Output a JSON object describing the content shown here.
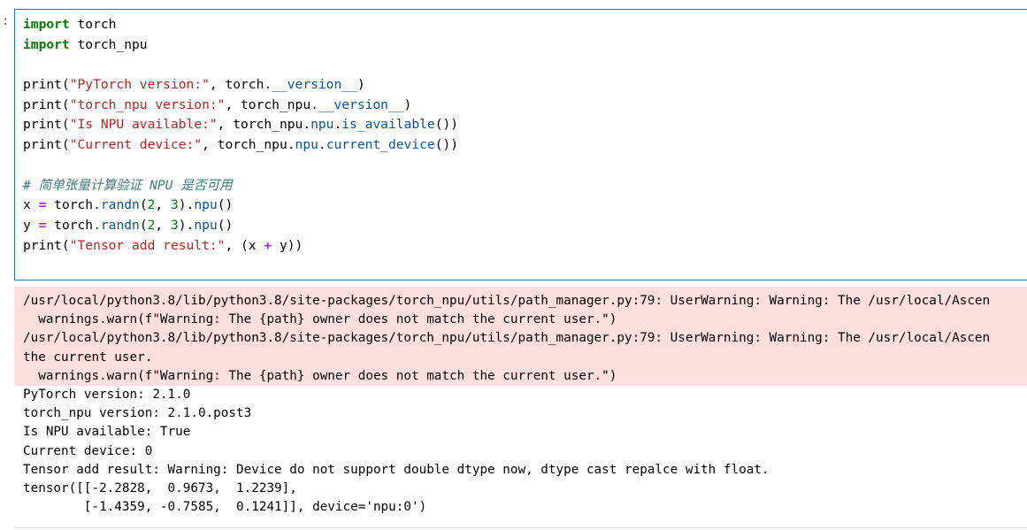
{
  "cell": {
    "prompt": ":",
    "code_lines": [
      [
        {
          "t": "kw",
          "v": "import"
        },
        {
          "t": "plain",
          "v": " torch"
        }
      ],
      [
        {
          "t": "kw",
          "v": "import"
        },
        {
          "t": "plain",
          "v": " torch_npu"
        }
      ],
      [],
      [
        {
          "t": "plain",
          "v": "print("
        },
        {
          "t": "str",
          "v": "\"PyTorch version:\""
        },
        {
          "t": "plain",
          "v": ", torch."
        },
        {
          "t": "attr",
          "v": "__version__"
        },
        {
          "t": "plain",
          "v": ")"
        }
      ],
      [
        {
          "t": "plain",
          "v": "print("
        },
        {
          "t": "str",
          "v": "\"torch_npu version:\""
        },
        {
          "t": "plain",
          "v": ", torch_npu."
        },
        {
          "t": "attr",
          "v": "__version__"
        },
        {
          "t": "plain",
          "v": ")"
        }
      ],
      [
        {
          "t": "plain",
          "v": "print("
        },
        {
          "t": "str",
          "v": "\"Is NPU available:\""
        },
        {
          "t": "plain",
          "v": ", torch_npu."
        },
        {
          "t": "attr",
          "v": "npu"
        },
        {
          "t": "plain",
          "v": "."
        },
        {
          "t": "attr",
          "v": "is_available"
        },
        {
          "t": "plain",
          "v": "())"
        }
      ],
      [
        {
          "t": "plain",
          "v": "print("
        },
        {
          "t": "str",
          "v": "\"Current device:\""
        },
        {
          "t": "plain",
          "v": ", torch_npu."
        },
        {
          "t": "attr",
          "v": "npu"
        },
        {
          "t": "plain",
          "v": "."
        },
        {
          "t": "attr",
          "v": "current_device"
        },
        {
          "t": "plain",
          "v": "())"
        }
      ],
      [],
      [
        {
          "t": "cmt",
          "v": "# 简单张量计算验证 NPU 是否可用"
        }
      ],
      [
        {
          "t": "plain",
          "v": "x "
        },
        {
          "t": "op",
          "v": "="
        },
        {
          "t": "plain",
          "v": " torch."
        },
        {
          "t": "attr",
          "v": "randn"
        },
        {
          "t": "plain",
          "v": "("
        },
        {
          "t": "num",
          "v": "2"
        },
        {
          "t": "plain",
          "v": ", "
        },
        {
          "t": "num",
          "v": "3"
        },
        {
          "t": "plain",
          "v": ")."
        },
        {
          "t": "attr",
          "v": "npu"
        },
        {
          "t": "plain",
          "v": "()"
        }
      ],
      [
        {
          "t": "plain",
          "v": "y "
        },
        {
          "t": "op",
          "v": "="
        },
        {
          "t": "plain",
          "v": " torch."
        },
        {
          "t": "attr",
          "v": "randn"
        },
        {
          "t": "plain",
          "v": "("
        },
        {
          "t": "num",
          "v": "2"
        },
        {
          "t": "plain",
          "v": ", "
        },
        {
          "t": "num",
          "v": "3"
        },
        {
          "t": "plain",
          "v": ")."
        },
        {
          "t": "attr",
          "v": "npu"
        },
        {
          "t": "plain",
          "v": "()"
        }
      ],
      [
        {
          "t": "plain",
          "v": "print("
        },
        {
          "t": "str",
          "v": "\"Tensor add result:\""
        },
        {
          "t": "plain",
          "v": ", (x "
        },
        {
          "t": "op",
          "v": "+"
        },
        {
          "t": "plain",
          "v": " y))"
        }
      ]
    ]
  },
  "output": {
    "stderr_lines": [
      "/usr/local/python3.8/lib/python3.8/site-packages/torch_npu/utils/path_manager.py:79: UserWarning: Warning: The /usr/local/Ascen",
      "  warnings.warn(f\"Warning: The {path} owner does not match the current user.\")",
      "/usr/local/python3.8/lib/python3.8/site-packages/torch_npu/utils/path_manager.py:79: UserWarning: Warning: The /usr/local/Ascen",
      "the current user.",
      "  warnings.warn(f\"Warning: The {path} owner does not match the current user.\")"
    ],
    "stdout_lines": [
      "PyTorch version: 2.1.0",
      "torch_npu version: 2.1.0.post3",
      "Is NPU available: True",
      "Current device: 0",
      "Tensor add result: Warning: Device do not support double dtype now, dtype cast repalce with float.",
      "tensor([[-2.2828,  0.9673,  1.2239],",
      "        [-1.4359, -0.7585,  0.1241]], device='npu:0')"
    ]
  },
  "colors": {
    "cell_border": "#1976d2",
    "stderr_background": "#fddfdd",
    "keyword": "#008000",
    "string": "#ba2121",
    "attribute": "#0055aa",
    "operator": "#aa22ff",
    "comment": "#3d7b7b"
  }
}
